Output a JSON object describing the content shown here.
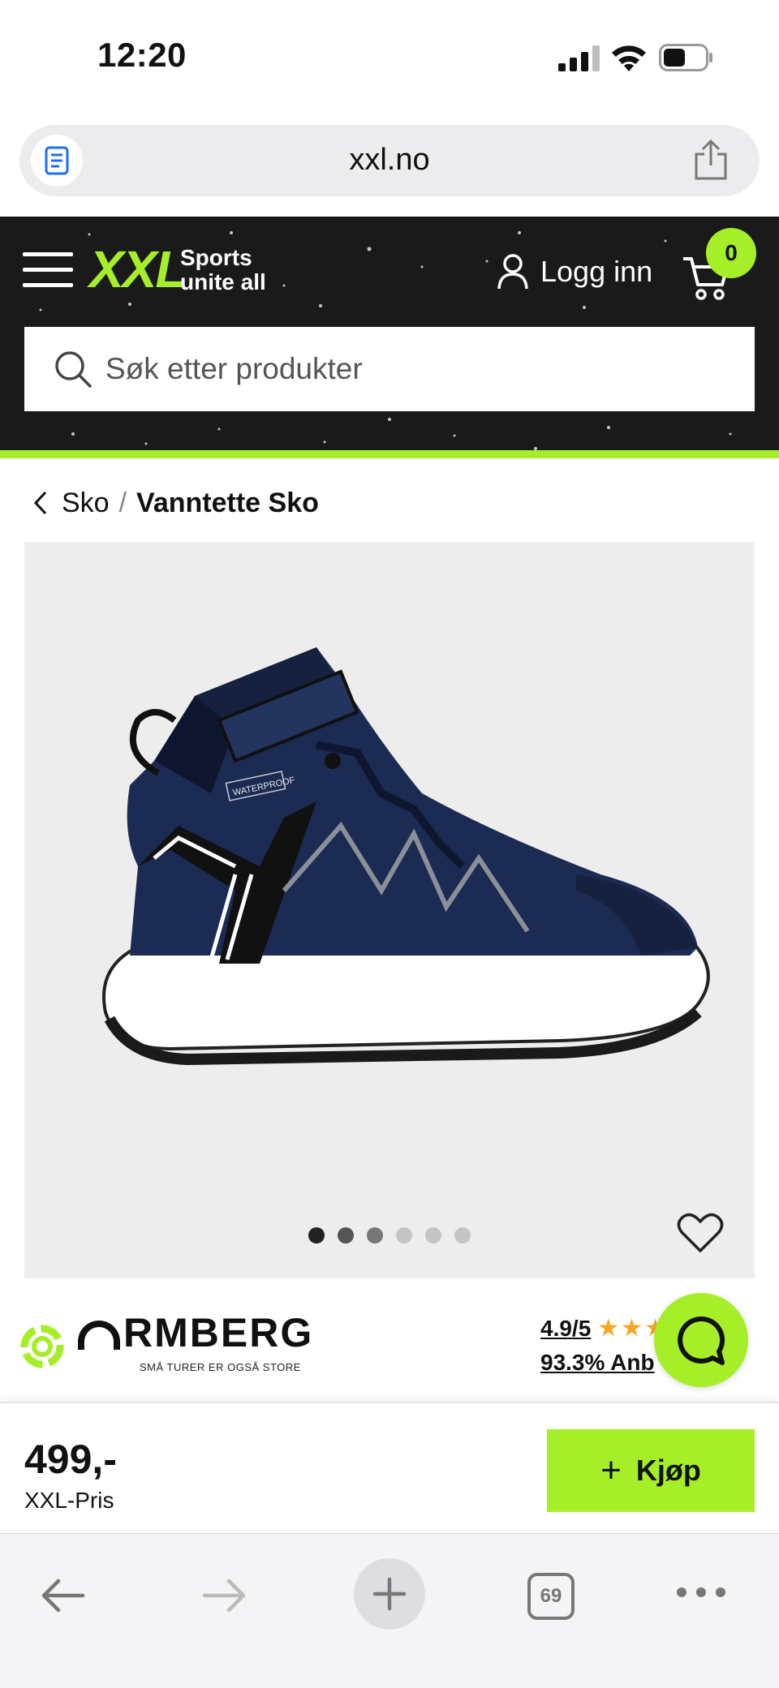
{
  "status_bar": {
    "time": "12:20"
  },
  "browser": {
    "url": "xxl.no",
    "tab_count": "69"
  },
  "header": {
    "logo": "XXL",
    "tagline_line1": "Sports",
    "tagline_line2": "unite all",
    "login_label": "Logg inn",
    "cart_count": "0",
    "search_placeholder": "Søk etter produkter",
    "colors": {
      "background": "#1a1a1a",
      "accent": "#a6ee27"
    }
  },
  "breadcrumb": {
    "parent": "Sko",
    "separator": "/",
    "current": "Vanntette Sko"
  },
  "gallery": {
    "image_count": 6,
    "active_index": 0,
    "image_alt": "Navy waterproof kids boot",
    "shoe_text": "WATERPROOF"
  },
  "brand": {
    "name": "RMBERG",
    "subtitle": "SMÅ TURER ER OGSÅ STORE"
  },
  "rating": {
    "score": "4.9/5",
    "stars": "★★★★★",
    "recommend": "93.3% Anb"
  },
  "buy": {
    "price": "499,-",
    "price_label": "XXL-Pris",
    "button_label": "Kjøp",
    "plus": "+"
  },
  "icons": {
    "reader": "reader-icon",
    "share": "share-icon",
    "menu": "hamburger-icon",
    "user": "user-icon",
    "cart": "cart-icon",
    "search": "search-icon",
    "back": "chevron-left-icon",
    "favorite": "heart-icon",
    "chat": "chat-icon"
  }
}
